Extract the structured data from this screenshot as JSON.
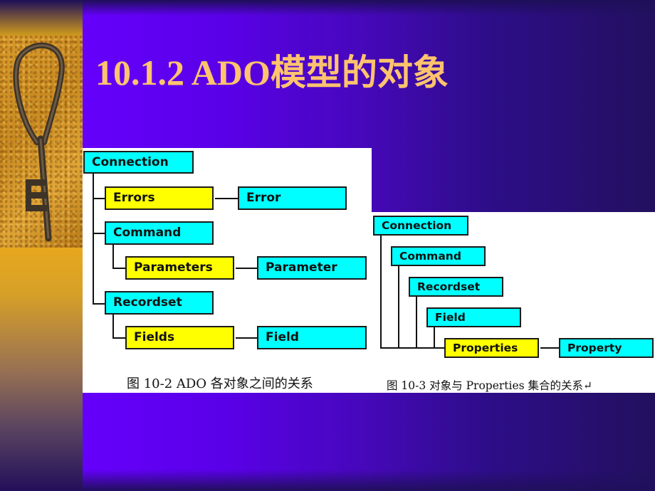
{
  "slide": {
    "title": "10.1.2  ADO模型的对象",
    "colors": {
      "title": "#ffc36e",
      "background_left": "#6500fb",
      "background_right": "#22105e",
      "cyan_box": "#00ffff",
      "yellow_box": "#ffff00"
    }
  },
  "sidebar": {
    "image": "rusty-key-on-sand-icon"
  },
  "figure1": {
    "caption": "图 10-2   ADO 各对象之间的关系",
    "nodes": {
      "connection": "Connection",
      "errors": "Errors",
      "error": "Error",
      "command": "Command",
      "parameters": "Parameters",
      "parameter": "Parameter",
      "recordset": "Recordset",
      "fields": "Fields",
      "field": "Field"
    }
  },
  "figure2": {
    "caption": "图 10-3   对象与 Properties 集合的关系↵",
    "nodes": {
      "connection": "Connection",
      "command": "Command",
      "recordset": "Recordset",
      "field": "Field",
      "properties": "Properties",
      "property": "Property"
    }
  }
}
